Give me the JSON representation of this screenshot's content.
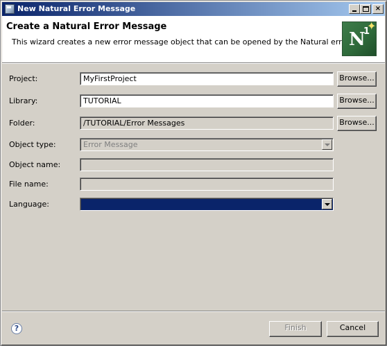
{
  "window": {
    "title": "New Natural Error Message",
    "controls": {
      "minimize": "minimize",
      "maximize": "maximize",
      "close": "×"
    }
  },
  "header": {
    "title": "Create a Natural Error Message",
    "description": "This wizard creates a new error message object that can be opened by the Natural error editor.",
    "logo": {
      "letter": "N",
      "superscript": "1",
      "star": "✦"
    }
  },
  "form": {
    "project": {
      "label": "Project:",
      "value": "MyFirstProject",
      "browse": "Browse..."
    },
    "library": {
      "label": "Library:",
      "value": "TUTORIAL",
      "browse": "Browse..."
    },
    "folder": {
      "label": "Folder:",
      "value": "/TUTORIAL/Error Messages",
      "browse": "Browse..."
    },
    "object_type": {
      "label": "Object type:",
      "value": "Error Message"
    },
    "object_name": {
      "label": "Object name:",
      "value": ""
    },
    "file_name": {
      "label": "File name:",
      "value": ""
    },
    "language": {
      "label": "Language:",
      "value": ""
    }
  },
  "footer": {
    "help": "?",
    "finish": "Finish",
    "cancel": "Cancel"
  },
  "colors": {
    "title_bar_start": "#0a246a",
    "title_bar_end": "#a6caf0",
    "selection": "#0a246a",
    "face": "#d4d0c8",
    "logo_green": "#2f6b3b"
  }
}
